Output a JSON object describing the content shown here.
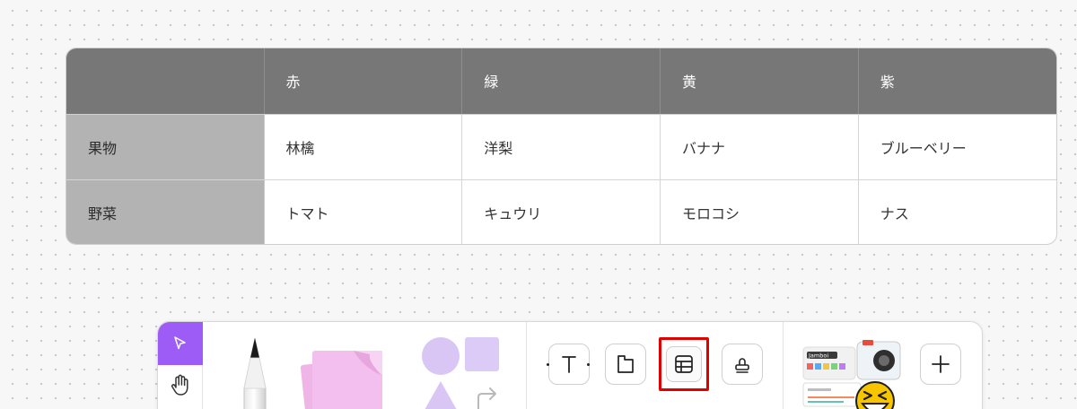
{
  "table": {
    "headers": [
      "",
      "赤",
      "緑",
      "黄",
      "紫"
    ],
    "rows": [
      {
        "label": "果物",
        "cells": [
          "林檎",
          "洋梨",
          "バナナ",
          "ブルーベリー"
        ]
      },
      {
        "label": "野菜",
        "cells": [
          "トマト",
          "キュウリ",
          "モロコシ",
          "ナス"
        ]
      }
    ]
  },
  "toolbar": {
    "accent_color": "#9d5cf5",
    "highlight_color": "#e00000",
    "tools": [
      {
        "name": "select",
        "icon": "cursor-icon",
        "active": true
      },
      {
        "name": "hand",
        "icon": "hand-icon"
      },
      {
        "name": "pen",
        "icon": "pen-icon"
      },
      {
        "name": "sticky-note",
        "icon": "sticky-note-icon"
      },
      {
        "name": "shapes",
        "icon": "shapes-icon"
      },
      {
        "name": "text",
        "icon": "text-icon"
      },
      {
        "name": "frame",
        "icon": "frame-icon"
      },
      {
        "name": "table",
        "icon": "table-icon",
        "highlighted": true
      },
      {
        "name": "stamp",
        "icon": "stamp-icon"
      },
      {
        "name": "stickers",
        "icon": "stickers-icon"
      },
      {
        "name": "more",
        "icon": "plus-icon"
      }
    ],
    "sticker_card_text": "Jamboi"
  }
}
